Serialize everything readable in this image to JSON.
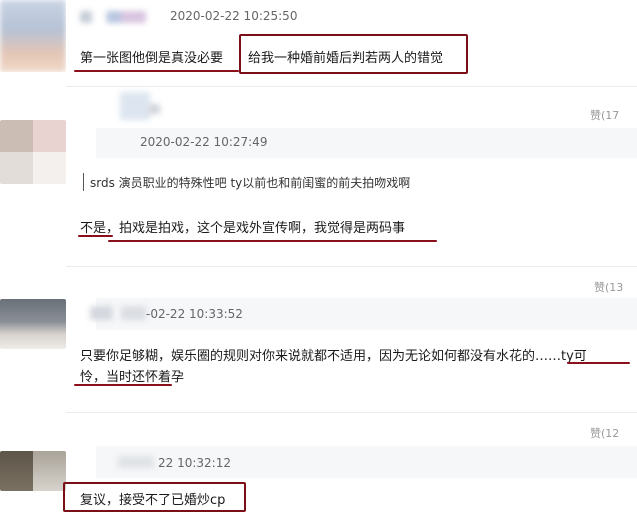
{
  "comments": [
    {
      "timestamp": "2020-02-22 10:25:50",
      "text_part1": "第一张图他倒是真没必要",
      "text_part2": "给我一种婚前婚后判若两人的错觉"
    },
    {
      "like_label": "赞",
      "like_count": "(17",
      "timestamp": "2020-02-22 10:27:49",
      "quote": "srds 演员职业的特殊性吧 ty以前也和前闺蜜的前夫拍吻戏啊",
      "reply": "不是，拍戏是拍戏，这个是戏外宣传啊，我觉得是两码事"
    },
    {
      "like_label": "赞",
      "like_count": "(13",
      "timestamp": "-02-22 10:33:52",
      "text_line1": "只要你足够糊，娱乐圈的规则对你来说就都不适用，因为无论如何都没有水花的……ty可",
      "text_line2": "怜，当时还怀着孕"
    },
    {
      "like_label": "赞",
      "like_count": "(12",
      "timestamp": "22 10:32:12",
      "text": "复议，接受不了已婚炒cp"
    }
  ],
  "colors": {
    "annotation": "#7a0f17",
    "timestamp": "#666666",
    "like": "#999999"
  }
}
